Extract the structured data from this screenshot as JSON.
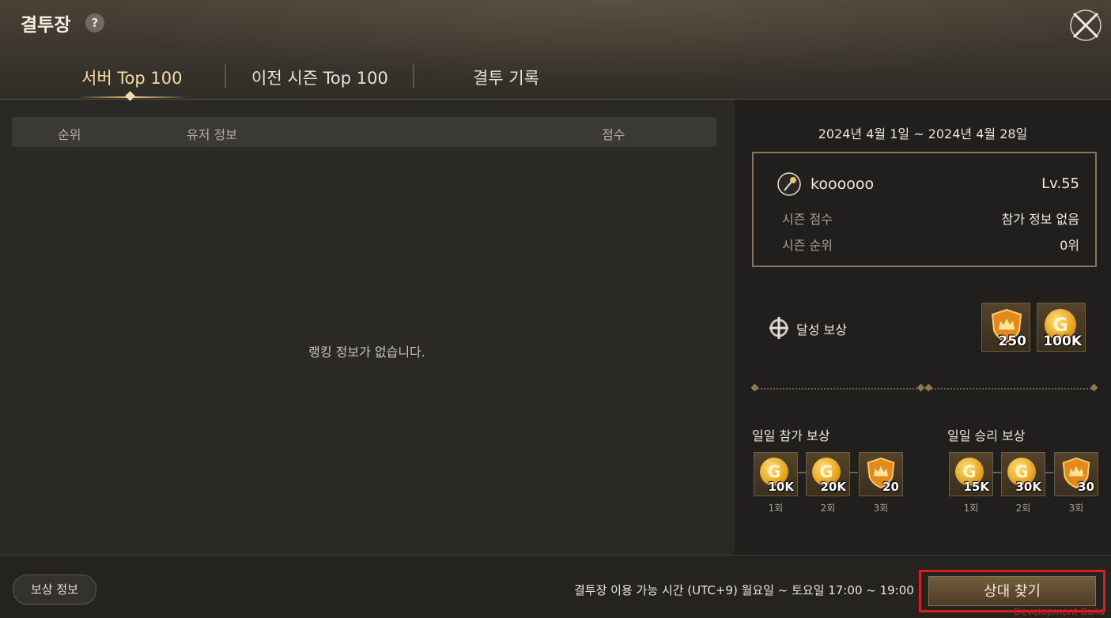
{
  "header": {
    "title": "결투장",
    "help": "?",
    "tabs": [
      {
        "label": "서버 Top 100",
        "active": true
      },
      {
        "label": "이전 시즌 Top 100",
        "active": false
      },
      {
        "label": "결투 기록",
        "active": false
      }
    ]
  },
  "ranking": {
    "columns": [
      "순위",
      "유저 정보",
      "점수"
    ],
    "empty_message": "랭킹 정보가 없습니다."
  },
  "season": {
    "date_range": "2024년 4월 1일 ~ 2024년 4월 28일",
    "profile": {
      "name": "koooooo",
      "level": "Lv.55",
      "score_label": "시즌 점수",
      "score_value": "참가 정보 없음",
      "rank_label": "시즌 순위",
      "rank_value": "0위"
    },
    "achievement": {
      "label": "달성 보상",
      "rewards": [
        {
          "icon": "crown-shield-icon",
          "amount": "250"
        },
        {
          "icon": "gold-coin-icon",
          "amount": "100K"
        }
      ]
    },
    "daily_participation": {
      "label": "일일 참가 보상",
      "rewards": [
        {
          "icon": "gold-coin-icon",
          "amount": "10K",
          "count": "1회"
        },
        {
          "icon": "gold-coin-icon",
          "amount": "20K",
          "count": "2회"
        },
        {
          "icon": "crown-shield-icon",
          "amount": "20",
          "count": "3회"
        }
      ]
    },
    "daily_victory": {
      "label": "일일 승리 보상",
      "rewards": [
        {
          "icon": "gold-coin-icon",
          "amount": "15K",
          "count": "1회"
        },
        {
          "icon": "gold-coin-icon",
          "amount": "30K",
          "count": "2회"
        },
        {
          "icon": "crown-shield-icon",
          "amount": "30",
          "count": "3회"
        }
      ]
    }
  },
  "footer": {
    "reward_info": "보상 정보",
    "hours": "결투장 이용 가능 시간 (UTC+9)  월요일 ~ 토요일 17:00 ~ 19:00",
    "find_button": "상대 찾기",
    "watermark": "Development Build"
  },
  "colors": {
    "accent_gold": "#f0cd8a",
    "highlight_red": "#d81e1e"
  }
}
